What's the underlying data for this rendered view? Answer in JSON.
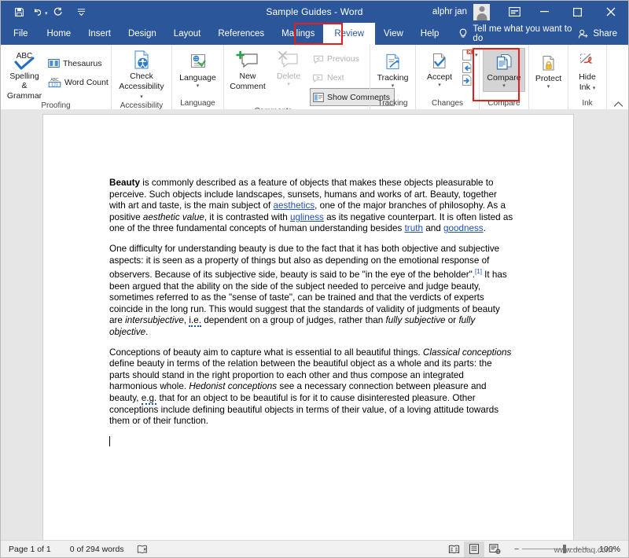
{
  "window": {
    "title": "Sample Guides  -  Word",
    "account_name": "alphr jan",
    "quick_access": [
      {
        "name": "save",
        "label": "Save"
      },
      {
        "name": "undo",
        "label": "Undo"
      },
      {
        "name": "redo",
        "label": "Redo"
      },
      {
        "name": "customize-qat",
        "label": "Customize Quick Access Toolbar"
      }
    ],
    "controls": [
      {
        "name": "ribbon-display-options",
        "label": "Ribbon Display Options"
      },
      {
        "name": "minimize",
        "label": "Minimize"
      },
      {
        "name": "restore",
        "label": "Restore Down"
      },
      {
        "name": "close",
        "label": "Close"
      }
    ],
    "titlebar_color": "#2b579a"
  },
  "tabs": {
    "items": [
      {
        "label": "File",
        "active": false
      },
      {
        "label": "Home",
        "active": false
      },
      {
        "label": "Insert",
        "active": false
      },
      {
        "label": "Design",
        "active": false
      },
      {
        "label": "Layout",
        "active": false
      },
      {
        "label": "References",
        "active": false
      },
      {
        "label": "Mailings",
        "active": false
      },
      {
        "label": "Review",
        "active": true
      },
      {
        "label": "View",
        "active": false
      },
      {
        "label": "Help",
        "active": false
      }
    ],
    "tellme": "Tell me what you want to do",
    "share": "Share",
    "highlight_color": "#e41e1e"
  },
  "ribbon": {
    "groups": [
      {
        "label": "Proofing",
        "buttons": [
          {
            "label": "Spelling &\nGrammar",
            "icon": "abc-check-icon",
            "disabled": false
          },
          {
            "label": "Thesaurus",
            "icon": "book-icon",
            "disabled": false
          },
          {
            "label": "Word Count",
            "icon": "abc-123-icon",
            "disabled": false
          }
        ]
      },
      {
        "label": "Accessibility",
        "buttons": [
          {
            "label": "Check\nAccessibility",
            "icon": "accessibility-icon",
            "disabled": false
          }
        ]
      },
      {
        "label": "Language",
        "buttons": [
          {
            "label": "Language",
            "icon": "language-icon",
            "disabled": false
          }
        ]
      },
      {
        "label": "Comments",
        "buttons": [
          {
            "label": "New\nComment",
            "icon": "new-comment-icon",
            "disabled": false
          },
          {
            "label": "Delete",
            "icon": "delete-comment-icon",
            "disabled": true
          },
          {
            "label": "Previous",
            "icon": "previous-comment-icon",
            "disabled": true
          },
          {
            "label": "Next",
            "icon": "next-comment-icon",
            "disabled": true
          },
          {
            "label": "Show Comments",
            "icon": "show-comments-icon",
            "disabled": false
          }
        ]
      },
      {
        "label": "Tracking",
        "buttons": [
          {
            "label": "Tracking",
            "icon": "track-changes-icon",
            "disabled": false
          }
        ]
      },
      {
        "label": "Changes",
        "buttons": [
          {
            "label": "Accept",
            "icon": "accept-icon",
            "disabled": false
          },
          {
            "label": "Reject",
            "icon": "reject-icon",
            "disabled": false
          },
          {
            "label": "Previous Change",
            "icon": "previous-change-icon",
            "disabled": false
          },
          {
            "label": "Next Change",
            "icon": "next-change-icon",
            "disabled": false
          }
        ]
      },
      {
        "label": "Compare",
        "buttons": [
          {
            "label": "Compare",
            "icon": "compare-icon",
            "disabled": false,
            "selected": true
          }
        ]
      },
      {
        "label": "Ink",
        "buttons": [
          {
            "label": "Protect",
            "icon": "protect-icon",
            "disabled": false
          },
          {
            "label": "Hide\nInk",
            "icon": "hide-ink-icon",
            "disabled": false
          }
        ]
      }
    ],
    "labels": {
      "spelling_grammar_l1": "Spelling &",
      "spelling_grammar_l2": "Grammar",
      "thesaurus": "Thesaurus",
      "word_count": "Word Count",
      "proofing": "Proofing",
      "check_l1": "Check",
      "check_l2": "Accessibility",
      "accessibility": "Accessibility",
      "language": "Language",
      "language_group": "Language",
      "new_l1": "New",
      "new_l2": "Comment",
      "delete": "Delete",
      "previous": "Previous",
      "next": "Next",
      "show_comments": "Show Comments",
      "comments": "Comments",
      "tracking": "Tracking",
      "accept": "Accept",
      "changes": "Changes",
      "compare": "Compare",
      "compare_group": "Compare",
      "protect": "Protect",
      "hide_l1": "Hide",
      "hide_l2": "Ink",
      "ink": "Ink"
    },
    "collapse_label": "Collapse the Ribbon"
  },
  "document": {
    "paragraphs": [
      {
        "id": "p1",
        "runs": [
          {
            "t": "Beauty",
            "style": "bold"
          },
          {
            "t": " is commonly described as a feature of objects that makes these objects pleasurable to perceive. Such objects include landscapes, sunsets, humans and works of art. Beauty, together with art and taste, is the main subject of ",
            "style": "normal"
          },
          {
            "t": "aesthetics",
            "style": "link"
          },
          {
            "t": ", one of the major branches of philosophy. As a positive ",
            "style": "normal"
          },
          {
            "t": "aesthetic value",
            "style": "italic"
          },
          {
            "t": ", it is contrasted with ",
            "style": "normal"
          },
          {
            "t": "ugliness",
            "style": "link"
          },
          {
            "t": " as its negative counterpart. It is often listed as one of the three fundamental concepts of human understanding besides ",
            "style": "normal"
          },
          {
            "t": "truth",
            "style": "link"
          },
          {
            "t": " and ",
            "style": "normal"
          },
          {
            "t": "goodness",
            "style": "link"
          },
          {
            "t": ".",
            "style": "normal"
          }
        ]
      },
      {
        "id": "p2",
        "runs": [
          {
            "t": "One difficulty for understanding beauty is due to the fact that it has both objective and subjective aspects: it is seen as a property of things but also as depending on the emotional response of observers. Because of its subjective side, beauty is said to be \"in the eye of the beholder\".",
            "style": "normal"
          },
          {
            "t": "[1]",
            "style": "sup"
          },
          {
            "t": " It has been argued that the ability on the side of the subject needed to perceive and judge beauty, sometimes referred to as the \"sense of taste\", can be trained and that the verdicts of experts coincide in the long run. This would suggest that the standards of validity of judgments of beauty are ",
            "style": "normal"
          },
          {
            "t": "intersubjective",
            "style": "italic"
          },
          {
            "t": ", ",
            "style": "normal"
          },
          {
            "t": "i.e.",
            "style": "squiggle"
          },
          {
            "t": " dependent on a group of judges, rather than ",
            "style": "normal"
          },
          {
            "t": "fully subjective",
            "style": "italic"
          },
          {
            "t": " or ",
            "style": "normal"
          },
          {
            "t": "fully objective",
            "style": "italic"
          },
          {
            "t": ".",
            "style": "normal"
          }
        ]
      },
      {
        "id": "p3",
        "runs": [
          {
            "t": "Conceptions of beauty aim to capture what is essential to all beautiful things. ",
            "style": "normal"
          },
          {
            "t": "Classical conceptions",
            "style": "italic"
          },
          {
            "t": " define beauty in terms of the relation between the beautiful object as a whole and its parts: the parts should stand in the right proportion to each other and thus compose an integrated harmonious whole. ",
            "style": "normal"
          },
          {
            "t": "Hedonist conceptions",
            "style": "italic"
          },
          {
            "t": " see a necessary connection between pleasure and beauty, ",
            "style": "normal"
          },
          {
            "t": "e.g.",
            "style": "squiggle"
          },
          {
            "t": " that for an object to be beautiful is for it to cause disinterested pleasure. Other conceptions include defining beautiful objects in terms of their value, of a loving attitude towards them or of their function.",
            "style": "normal"
          }
        ]
      }
    ]
  },
  "statusbar": {
    "page_info": "Page 1 of 1",
    "word_count": "0 of 294 words",
    "proofing_icon": "proofing-status-icon",
    "views": [
      {
        "name": "read-mode",
        "label": "Read Mode",
        "active": false
      },
      {
        "name": "print-layout",
        "label": "Print Layout",
        "active": true
      },
      {
        "name": "web-layout",
        "label": "Web Layout",
        "active": false
      }
    ],
    "zoom_out": "−",
    "zoom_in": "+",
    "zoom_level": "100%"
  },
  "watermark": "www.debaq.com"
}
